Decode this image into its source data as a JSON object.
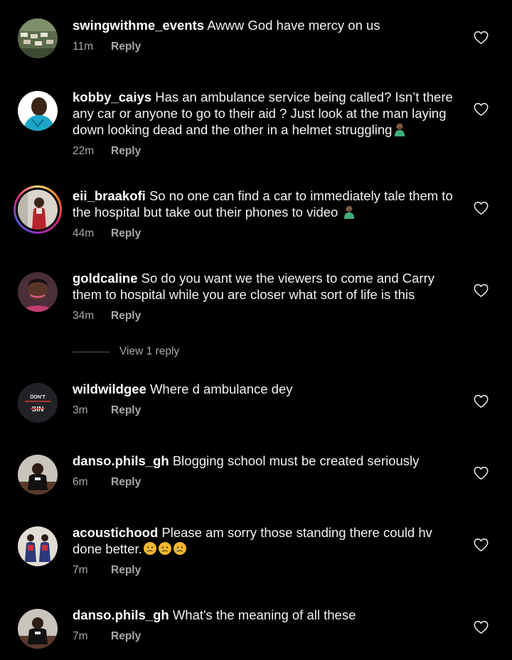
{
  "comments": [
    {
      "username": "swingwithme_events",
      "text": "Awww God have mercy on us",
      "time": "11m",
      "reply_label": "Reply"
    },
    {
      "username": "kobby_caiys",
      "text": "Has an ambulance service being called? Isn’t there any car or anyone to go to their aid ? Just look at the man laying down looking dead and the other in a helmet struggling",
      "time": "22m",
      "reply_label": "Reply"
    },
    {
      "username": "eii_braakofi",
      "text": "So no one can find a car to immediately tale them to the hospital but take out their phones to video",
      "time": "44m",
      "reply_label": "Reply"
    },
    {
      "username": "goldcaline",
      "text": "So do you want we the viewers to come and Carry them to hospital while you are closer what sort of life is this",
      "time": "34m",
      "reply_label": "Reply",
      "view_replies": "View 1 reply"
    },
    {
      "username": "wildwildgee",
      "text": "Where d ambulance dey",
      "time": "3m",
      "reply_label": "Reply",
      "avatar_text_top": "DON'T",
      "avatar_text_bottom": "SIN"
    },
    {
      "username": "danso.phils_gh",
      "text": "Blogging school must be created seriously",
      "time": "6m",
      "reply_label": "Reply"
    },
    {
      "username": "acoustichood",
      "text": "Please am sorry those standing there could hv done better.",
      "time": "7m",
      "reply_label": "Reply"
    },
    {
      "username": "danso.phils_gh",
      "text": "What's the meaning of all these",
      "time": "7m",
      "reply_label": "Reply"
    }
  ],
  "icons": {
    "like": "heart-outline-icon",
    "facepalm": "person-facepalming-emoji",
    "crying": "crying-face-emoji"
  },
  "colors": {
    "background": "#000000",
    "text": "#f2f2f2",
    "secondary": "#a8a8a8"
  }
}
